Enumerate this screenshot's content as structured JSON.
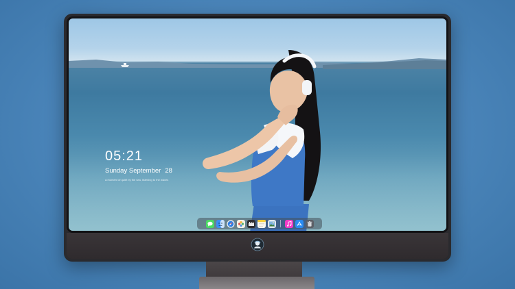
{
  "desktop": {
    "clock": "05:21",
    "date_weekday_month": "Sunday September",
    "date_day": "28",
    "tagline": "A moment of quiet by the sea, listening to the waves"
  },
  "dock": {
    "items": [
      {
        "icon": "messages-icon",
        "color": "#4cd964"
      },
      {
        "icon": "finder-icon",
        "color": "#3b8ef3"
      },
      {
        "icon": "safari-icon",
        "color": "#e9edf2"
      },
      {
        "icon": "photos-icon",
        "color": "#f2d14a"
      },
      {
        "icon": "film-icon",
        "color": "#2d2d31"
      },
      {
        "icon": "notes-icon",
        "color": "#f6e27a"
      },
      {
        "icon": "preview-icon",
        "color": "#7fb3e0"
      },
      {
        "icon": "music-icon",
        "color": "#f23ac7"
      },
      {
        "icon": "app-store-icon",
        "color": "#2a8bf2"
      },
      {
        "icon": "trash-icon",
        "color": "#5c5f66"
      }
    ]
  },
  "colors": {
    "page_background": "#4d88bd",
    "monitor_frame": "#2a2a2e",
    "sea": "#3e7aa0",
    "sky": "#b4d3ea"
  }
}
